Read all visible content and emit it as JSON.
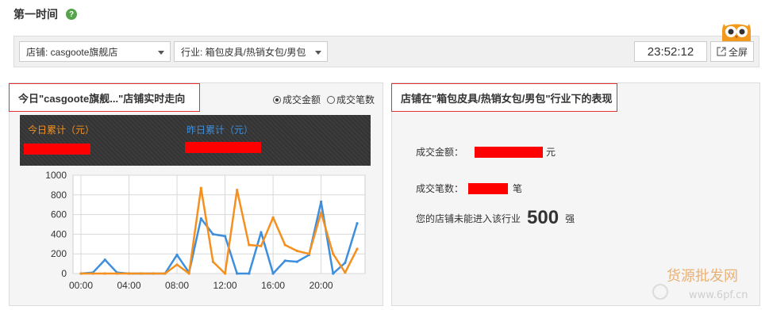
{
  "header": {
    "title": "第一时间",
    "help": "?"
  },
  "toolbar": {
    "shop_select": "店铺: casgoote旗舰店",
    "industry_select": "行业: 箱包皮具/热销女包/男包",
    "clock": "23:52:12",
    "fullscreen_label": "全屏"
  },
  "left_panel": {
    "title": "今日\"casgoote旗舰...\"店铺实时走向",
    "radio_amount": "成交金额",
    "radio_count": "成交笔数",
    "today_label": "今日累计（元）",
    "yesterday_label": "昨日累计（元）"
  },
  "right_panel": {
    "title": "店铺在\"箱包皮具/热销女包/男包\"行业下的表现",
    "amount_label": "成交金额：",
    "amount_unit": "元",
    "count_label": "成交笔数：",
    "count_unit": "笔",
    "rank_prefix": "您的店铺未能进入该行业",
    "rank_value": "500",
    "rank_suffix": "强"
  },
  "watermark": {
    "line1": "货源批发网",
    "line2": "www.6pf.cn"
  },
  "colors": {
    "today": "#f5901e",
    "yesterday": "#3d8fde",
    "redact": "#ff0000",
    "help": "#55a34a"
  },
  "chart_data": {
    "type": "line",
    "x": [
      "00:00",
      "01:00",
      "02:00",
      "03:00",
      "04:00",
      "05:00",
      "06:00",
      "07:00",
      "08:00",
      "09:00",
      "10:00",
      "11:00",
      "12:00",
      "13:00",
      "14:00",
      "15:00",
      "16:00",
      "17:00",
      "18:00",
      "19:00",
      "20:00",
      "21:00",
      "22:00",
      "23:00"
    ],
    "x_ticks": [
      "00:00",
      "04:00",
      "08:00",
      "12:00",
      "16:00",
      "20:00"
    ],
    "y_ticks": [
      "0",
      "200",
      "400",
      "600",
      "800",
      "1000"
    ],
    "ylim": [
      0,
      1000
    ],
    "grid": true,
    "series": [
      {
        "color": "#3d8fde",
        "values": [
          0,
          10,
          140,
          10,
          0,
          0,
          0,
          0,
          190,
          10,
          560,
          400,
          380,
          0,
          0,
          420,
          0,
          130,
          120,
          190,
          730,
          0,
          110,
          510
        ]
      },
      {
        "color": "#f5901e",
        "values": [
          0,
          0,
          0,
          0,
          0,
          0,
          0,
          0,
          90,
          0,
          870,
          120,
          0,
          850,
          290,
          280,
          570,
          290,
          230,
          200,
          620,
          200,
          10,
          250
        ]
      }
    ]
  }
}
